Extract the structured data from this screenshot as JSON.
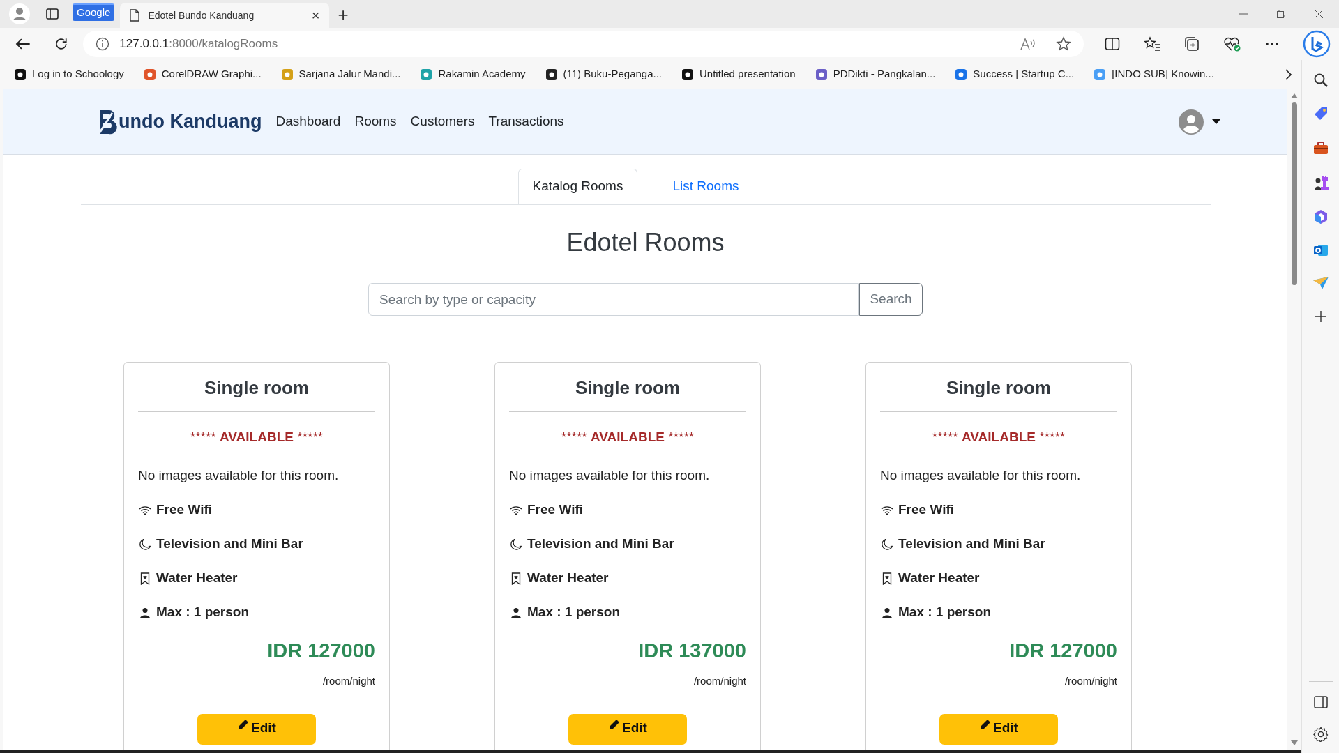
{
  "browser": {
    "tab_group": "Google",
    "tab_title": "Edotel Bundo Kanduang",
    "tab_close": "×",
    "new_tab": "+",
    "address_host": "127.0.0.1",
    "address_path": ":8000/katalogRooms",
    "bookmarks": [
      {
        "label": "Log in to Schoology",
        "color": "#111111"
      },
      {
        "label": "CorelDRAW Graphi...",
        "color": "#e0542a"
      },
      {
        "label": "Sarjana Jalur Mandi...",
        "color": "#d4a017"
      },
      {
        "label": "Rakamin Academy",
        "color": "#1fa3a8"
      },
      {
        "label": "(11) Buku-Peganga...",
        "color": "#222222"
      },
      {
        "label": "Untitled presentation",
        "color": "#111111"
      },
      {
        "label": "PDDikti - Pangkalan...",
        "color": "#6b5fc7"
      },
      {
        "label": "Success | Startup C...",
        "color": "#1a73e8"
      },
      {
        "label": "[INDO SUB] Knowin...",
        "color": "#4a9ff5"
      }
    ]
  },
  "navbar": {
    "brand": "undo Kanduang",
    "links": [
      "Dashboard",
      "Rooms",
      "Customers",
      "Transactions"
    ]
  },
  "tabs": [
    {
      "label": "Katalog Rooms",
      "selected": true
    },
    {
      "label": "List Rooms",
      "selected": false
    }
  ],
  "title": "Edotel Rooms",
  "search": {
    "placeholder": "Search by type or capacity",
    "button": "Search"
  },
  "rooms": [
    {
      "name": "Single room",
      "status_left": "*****",
      "status": "AVAILABLE",
      "status_right": "*****",
      "note": "No images available for this room.",
      "features": [
        {
          "kind": "wifi",
          "label": "Free Wifi"
        },
        {
          "kind": "moon",
          "label": "Television and Mini Bar"
        },
        {
          "kind": "bookmark",
          "label": "Water Heater"
        },
        {
          "kind": "person",
          "label": "Max : 1 person"
        }
      ],
      "price": "IDR 127000",
      "unit": "/room/night",
      "action": "Edit"
    },
    {
      "name": "Single room",
      "status_left": "*****",
      "status": "AVAILABLE",
      "status_right": "*****",
      "note": "No images available for this room.",
      "features": [
        {
          "kind": "wifi",
          "label": "Free Wifi"
        },
        {
          "kind": "moon",
          "label": "Television and Mini Bar"
        },
        {
          "kind": "bookmark",
          "label": "Water Heater"
        },
        {
          "kind": "person",
          "label": "Max : 1 person"
        }
      ],
      "price": "IDR 137000",
      "unit": "/room/night",
      "action": "Edit"
    },
    {
      "name": "Single room",
      "status_left": "*****",
      "status": "AVAILABLE",
      "status_right": "*****",
      "note": "No images available for this room.",
      "features": [
        {
          "kind": "wifi",
          "label": "Free Wifi"
        },
        {
          "kind": "moon",
          "label": "Television and Mini Bar"
        },
        {
          "kind": "bookmark",
          "label": "Water Heater"
        },
        {
          "kind": "person",
          "label": "Max : 1 person"
        }
      ],
      "price": "IDR 127000",
      "unit": "/room/night",
      "action": "Edit"
    }
  ]
}
